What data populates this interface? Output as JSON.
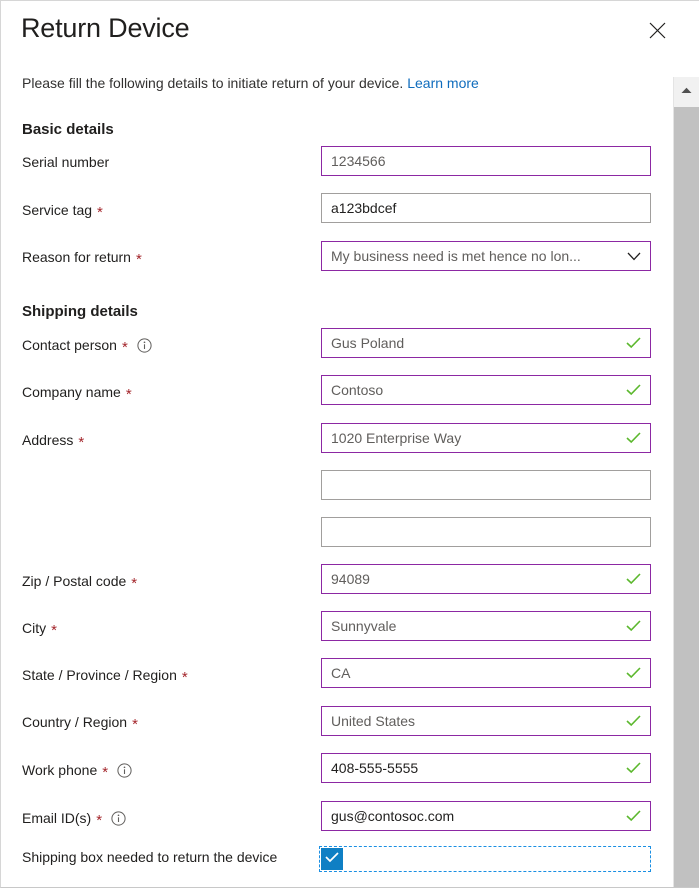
{
  "dialog": {
    "title": "Return Device",
    "close_label": "Close",
    "description": "Please fill the following details to initiate return of your device.",
    "learn_more": "Learn more"
  },
  "sections": [
    {
      "heading": "Basic details"
    },
    {
      "heading": "Shipping details"
    }
  ],
  "basic_details": {
    "heading": "Basic details",
    "fields": [
      {
        "label": "Serial number",
        "required": false,
        "value": "1234566",
        "state": "active",
        "muted": true,
        "valid": false
      },
      {
        "label": "Service tag",
        "required": true,
        "value": "a123bdcef",
        "state": "normal",
        "muted": false,
        "valid": false
      },
      {
        "label": "Reason for return",
        "required": true,
        "value": "My business need is met hence no lon...",
        "state": "active",
        "muted": true,
        "valid": false,
        "dropdown": true
      }
    ]
  },
  "shipping_details": {
    "heading": "Shipping details",
    "fields": [
      {
        "label": "Contact person",
        "required": true,
        "info": true,
        "value": "Gus Poland",
        "state": "active",
        "muted": true,
        "valid": true
      },
      {
        "label": "Company name",
        "required": true,
        "info": false,
        "value": "Contoso",
        "state": "active",
        "muted": true,
        "valid": true
      },
      {
        "label": "Address",
        "required": true,
        "info": false,
        "value": "1020 Enterprise Way",
        "state": "active",
        "muted": true,
        "valid": true
      },
      {
        "label": "",
        "required": false,
        "info": false,
        "value": "",
        "state": "normal",
        "muted": false,
        "valid": false
      },
      {
        "label": "",
        "required": false,
        "info": false,
        "value": "",
        "state": "normal",
        "muted": false,
        "valid": false
      },
      {
        "label": "Zip / Postal code",
        "required": true,
        "info": false,
        "value": "94089",
        "state": "active",
        "muted": true,
        "valid": true
      },
      {
        "label": "City",
        "required": true,
        "info": false,
        "value": "Sunnyvale",
        "state": "active",
        "muted": true,
        "valid": true
      },
      {
        "label": "State / Province / Region",
        "required": true,
        "info": false,
        "value": "CA",
        "state": "active",
        "muted": true,
        "valid": true
      },
      {
        "label": "Country / Region",
        "required": true,
        "info": false,
        "value": "United States",
        "state": "active",
        "muted": true,
        "valid": true
      },
      {
        "label": "Work phone",
        "required": true,
        "info": true,
        "value": "408-555-5555",
        "state": "active",
        "muted": false,
        "valid": true
      },
      {
        "label": "Email ID(s)",
        "required": true,
        "info": true,
        "value": "gus@contosoc.com",
        "state": "active",
        "muted": false,
        "valid": true
      }
    ]
  },
  "shipping_box": {
    "label": "Shipping box needed to return the device",
    "checked": true
  },
  "colors": {
    "accent_border": "#8c28a3",
    "valid_check": "#5cb82e",
    "required_asterisk": "#a4262c",
    "link": "#0f6cbd",
    "checkbox_fill": "#0f7fc4",
    "focus_outline": "#1a8fe3"
  },
  "scrollbar": {
    "up_arrow": "scroll-up"
  }
}
